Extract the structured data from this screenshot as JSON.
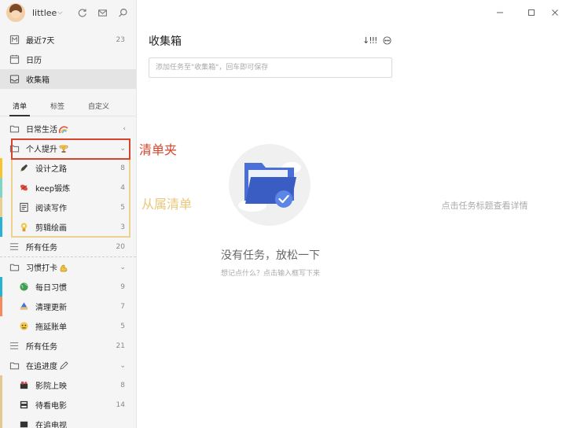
{
  "header": {
    "username": "littlee",
    "user_chevron": "⌵"
  },
  "nav": [
    {
      "label": "最近7天",
      "count": "23"
    },
    {
      "label": "日历",
      "count": ""
    },
    {
      "label": "收集箱",
      "count": ""
    }
  ],
  "tabs": [
    {
      "label": "清单"
    },
    {
      "label": "标签"
    },
    {
      "label": "自定义"
    }
  ],
  "lists": {
    "folder1": {
      "label": "日常生活",
      "arrow": "‹"
    },
    "folder2": {
      "label": "个人提升",
      "arrow": "⌄"
    },
    "folder2_items": [
      {
        "label": "设计之路",
        "count": "8"
      },
      {
        "label": "keep锻炼",
        "count": "4"
      },
      {
        "label": "阅读写作",
        "count": "5"
      },
      {
        "label": "剪辑绘画",
        "count": "3"
      }
    ],
    "folder2_all": {
      "label": "所有任务",
      "count": "20"
    },
    "folder3": {
      "label": "习惯打卡",
      "arrow": "⌄"
    },
    "folder3_items": [
      {
        "label": "每日习惯",
        "count": "9"
      },
      {
        "label": "清理更新",
        "count": "7"
      },
      {
        "label": "拖延账单",
        "count": "5"
      }
    ],
    "folder3_all": {
      "label": "所有任务",
      "count": "21"
    },
    "folder4": {
      "label": "在追进度",
      "arrow": "⌄"
    },
    "folder4_items": [
      {
        "label": "影院上映",
        "count": "8"
      },
      {
        "label": "待看电影",
        "count": "14"
      },
      {
        "label": "在追电视",
        "count": ""
      }
    ]
  },
  "main": {
    "title": "收集箱",
    "sort_label": "↓!!!",
    "add_placeholder": "添加任务至\"收集箱\"，回车即可保存",
    "empty_title": "没有任务，放松一下",
    "empty_sub": "想记点什么？点击输入框写下来"
  },
  "detail": {
    "hint": "点击任务标题查看详情"
  },
  "annotations": {
    "folder_label": "清单夹",
    "child_label": "从属清单"
  },
  "colors": {
    "stripe_yellow": "#f7c32e",
    "stripe_teal": "#7fd6c4",
    "stripe_gold": "#e7cf8e",
    "stripe_cyan": "#27b3d2",
    "stripe_orange": "#f28a5c",
    "stripe_tan": "#e2c792",
    "accent_blue": "#4a6fd6",
    "annotation_red": "#d4452b",
    "annotation_gold": "#e8c77a"
  }
}
